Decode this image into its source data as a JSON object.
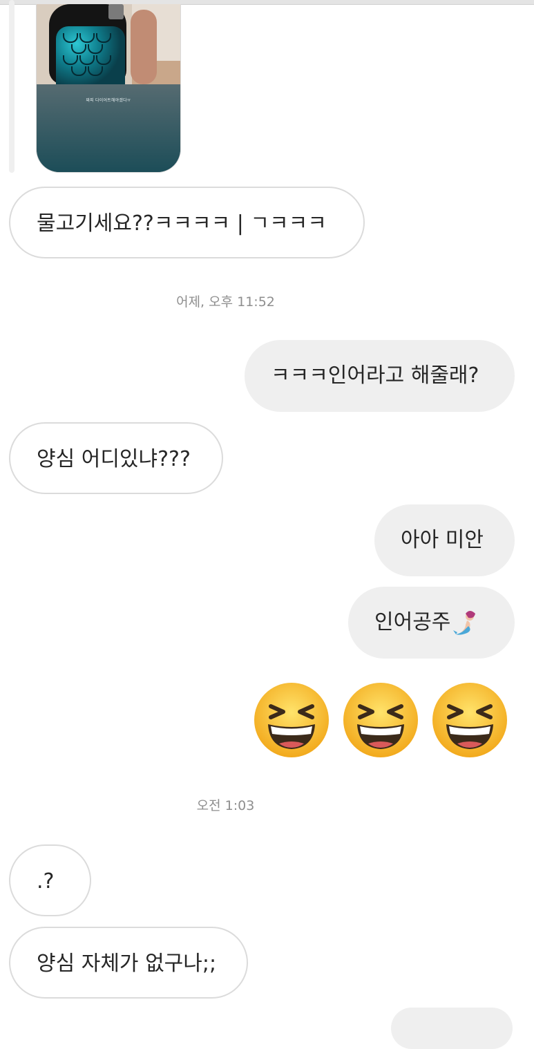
{
  "story_reply": {
    "caption": "짜피 다이어트해야겠다ㅠ",
    "icons": [
      "story-photo"
    ]
  },
  "messages": [
    {
      "side": "in",
      "text": "물고기세요??ㅋㅋㅋㅋ | ㄱㅋㅋㅋ"
    },
    {
      "side": "out",
      "text": "ㅋㅋㅋ인어라고 해줄래?"
    },
    {
      "side": "in",
      "text": "양심 어디있냐???"
    },
    {
      "side": "out",
      "text": "아아 미안"
    },
    {
      "side": "out",
      "text": "인어공주",
      "emoji": "mermaid-emoji"
    },
    {
      "side": "out",
      "emoji_only": [
        "grinning-squinting-face-emoji",
        "grinning-squinting-face-emoji",
        "grinning-squinting-face-emoji"
      ]
    },
    {
      "side": "in",
      "text": ".?"
    },
    {
      "side": "in",
      "text": "양심 자체가 없구나;;"
    }
  ],
  "timestamps": [
    "어제, 오후 11:52",
    "오전 1:03"
  ],
  "colors": {
    "incoming_bg": "#ffffff",
    "incoming_border": "#dbdbdb",
    "outgoing_bg": "#efefef",
    "timestamp": "#8e8e8e",
    "text": "#262626"
  }
}
